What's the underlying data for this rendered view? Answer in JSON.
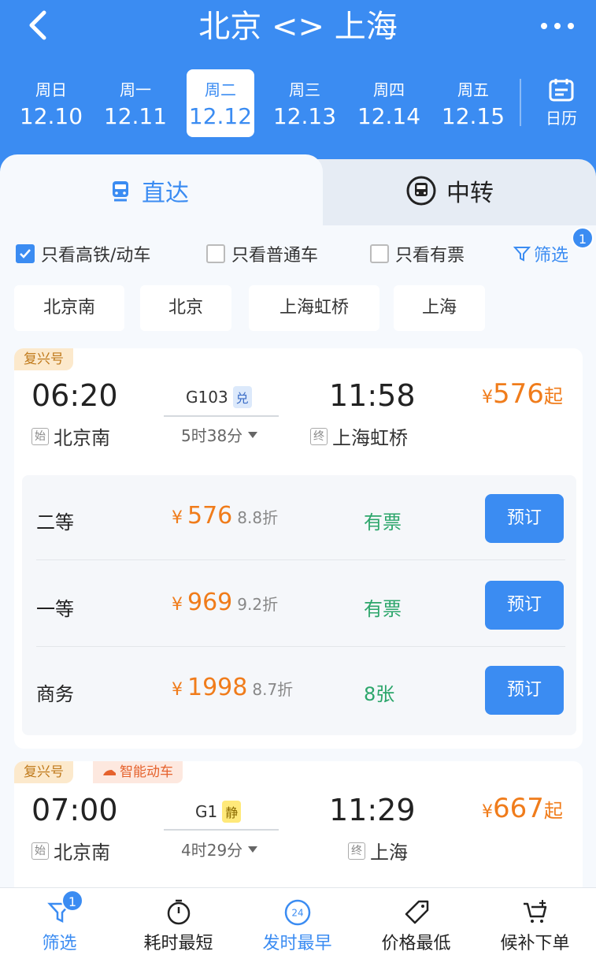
{
  "header": {
    "title": "北京 <> 上海",
    "bg": "#3b8cf2"
  },
  "dates": [
    {
      "weekday": "周日",
      "date": "12.10"
    },
    {
      "weekday": "周一",
      "date": "12.11"
    },
    {
      "weekday": "周二",
      "date": "12.12",
      "selected": true
    },
    {
      "weekday": "周三",
      "date": "12.13"
    },
    {
      "weekday": "周四",
      "date": "12.14"
    },
    {
      "weekday": "周五",
      "date": "12.15"
    }
  ],
  "calendar_label": "日历",
  "tabs": {
    "direct": "直达",
    "transfer": "中转"
  },
  "filters": {
    "hsr_only": "只看高铁/动车",
    "normal_only": "只看普通车",
    "available_only": "只看有票",
    "filter": "筛选",
    "filter_count": "1"
  },
  "stations": [
    "北京南",
    "北京",
    "上海虹桥",
    "上海"
  ],
  "trains": [
    {
      "tag": "复兴号",
      "depart_time": "06:20",
      "depart_badge": "始",
      "depart_station": "北京南",
      "train_no": "G103",
      "train_badge": "兑",
      "duration": "5时38分",
      "arrive_time": "11:58",
      "arrive_badge": "终",
      "arrive_station": "上海虹桥",
      "price_symbol": "¥",
      "price": "576",
      "price_suffix": "起",
      "seats": [
        {
          "class": "二等",
          "symbol": "¥",
          "price": "576",
          "discount": "8.8折",
          "availability": "有票",
          "book": "预订"
        },
        {
          "class": "一等",
          "symbol": "¥",
          "price": "969",
          "discount": "9.2折",
          "availability": "有票",
          "book": "预订"
        },
        {
          "class": "商务",
          "symbol": "¥",
          "price": "1998",
          "discount": "8.7折",
          "availability": "8张",
          "book": "预订"
        }
      ]
    },
    {
      "tag": "复兴号",
      "tag2": "智能动车",
      "depart_time": "07:00",
      "depart_badge": "始",
      "depart_station": "北京南",
      "train_no": "G1",
      "train_badge": "静",
      "duration": "4时29分",
      "arrive_time": "11:29",
      "arrive_badge": "终",
      "arrive_station": "上海",
      "price_symbol": "¥",
      "price": "667",
      "price_suffix": "起"
    }
  ],
  "bottom_bar": {
    "filter": "筛选",
    "filter_count": "1",
    "shortest": "耗时最短",
    "earliest": "发时最早",
    "earliest_icon_text": "24",
    "cheapest": "价格最低",
    "waitlist": "候补下单"
  }
}
